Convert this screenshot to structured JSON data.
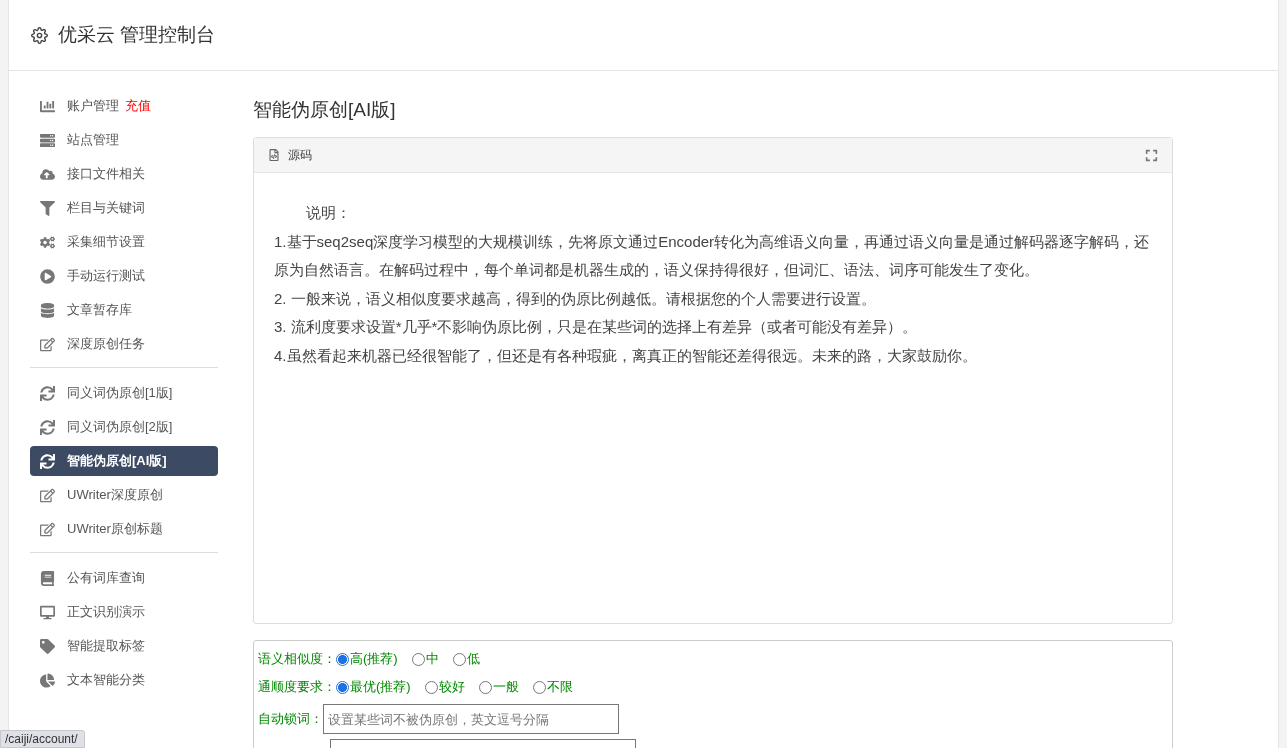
{
  "header": {
    "title": "优采云 管理控制台"
  },
  "sidebar": {
    "groups": [
      {
        "items": [
          {
            "label": "账户管理",
            "badge": "充值",
            "selected": false
          },
          {
            "label": "站点管理",
            "selected": false
          },
          {
            "label": "接口文件相关",
            "selected": false
          },
          {
            "label": "栏目与关键词",
            "selected": false
          },
          {
            "label": "采集细节设置",
            "selected": false
          },
          {
            "label": "手动运行测试",
            "selected": false
          },
          {
            "label": "文章暂存库",
            "selected": false
          },
          {
            "label": "深度原创任务",
            "selected": false
          }
        ]
      },
      {
        "items": [
          {
            "label": "同义词伪原创[1版]",
            "selected": false
          },
          {
            "label": "同义词伪原创[2版]",
            "selected": false
          },
          {
            "label": "智能伪原创[AI版]",
            "selected": true
          },
          {
            "label": "UWriter深度原创",
            "selected": false
          },
          {
            "label": "UWriter原创标题",
            "selected": false
          }
        ]
      },
      {
        "items": [
          {
            "label": "公有词库查询",
            "selected": false
          },
          {
            "label": "正文识别演示",
            "selected": false
          },
          {
            "label": "智能提取标签",
            "selected": false
          },
          {
            "label": "文本智能分类",
            "selected": false
          }
        ]
      }
    ]
  },
  "content": {
    "title": "智能伪原创[AI版]",
    "source_panel": {
      "tab": "源码",
      "lines": [
        "说明：",
        "1.基于seq2seq深度学习模型的大规模训练，先将原文通过Encoder转化为高维语义向量，再通过语义向量是通过解码器逐字解码，还原为自然语言。在解码过程中，每个单词都是机器生成的，语义保持得很好，但词汇、语法、词序可能发生了变化。",
        "2. 一般来说，语义相似度要求越高，得到的伪原比例越低。请根据您的个人需要进行设置。",
        "3. 流利度要求设置*几乎*不影响伪原比例，只是在某些词的选择上有差异（或者可能没有差异）。",
        "4.虽然看起来机器已经很智能了，但还是有各种瑕疵，离真正的智能还差得很远。未来的路，大家鼓励你。"
      ]
    },
    "options": [
      {
        "label": "语义相似度：",
        "choices": [
          {
            "label": "高(推荐)",
            "selected": true
          },
          {
            "label": "中",
            "selected": false
          },
          {
            "label": "低",
            "selected": false
          }
        ]
      },
      {
        "label": "通顺度要求：",
        "choices": [
          {
            "label": "最优(推荐)",
            "selected": true
          },
          {
            "label": "较好",
            "selected": false
          },
          {
            "label": "一般",
            "selected": false
          },
          {
            "label": "不限",
            "selected": false
          }
        ]
      }
    ],
    "lock_words": {
      "label": "自动锁词：",
      "placeholder": "设置某些词不被伪原创，英文逗号分隔"
    }
  },
  "status_url": "/caiji/account/"
}
